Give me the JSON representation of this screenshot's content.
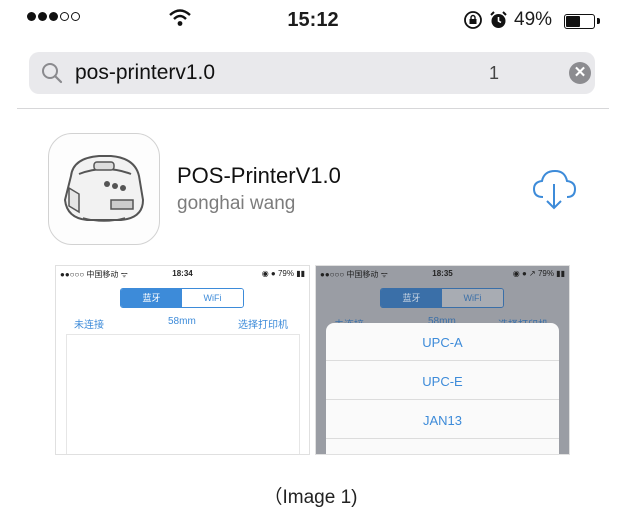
{
  "status_bar": {
    "signal_icon": "signal-dots-icon",
    "wifi_icon": "wifi-icon",
    "time": "15:12",
    "lock_icon": "rotation-lock-icon",
    "alarm_icon": "alarm-icon",
    "battery_text": "49%",
    "battery_level": 0.49
  },
  "search": {
    "value": "pos-printerv1.0",
    "result_count": "1",
    "search_icon": "search-icon",
    "clear_icon": "clear-icon"
  },
  "app": {
    "name": "POS-PrinterV1.0",
    "developer": "gonghai wang",
    "icon": "printer-app-icon",
    "download_icon": "cloud-download-icon"
  },
  "screenshot1": {
    "status_left": "●●○○○ 中国移动 ᯤ",
    "time": "18:34",
    "status_right": "◉ ● 79% ▮▮",
    "segments": [
      "蓝牙",
      "WiFi"
    ],
    "options": [
      "未连接",
      "58mm",
      "选择打印机"
    ]
  },
  "screenshot2": {
    "status_left": "●●○○○ 中国移动 ᯤ",
    "time": "18:35",
    "status_right": "◉ ● ↗ 79% ▮▮",
    "segments": [
      "蓝牙",
      "WiFi"
    ],
    "options": [
      "未连接",
      "58mm",
      "选择打印机"
    ],
    "sheet_items": [
      "UPC-A",
      "UPC-E",
      "JAN13"
    ]
  },
  "caption": "（Image 1)",
  "colors": {
    "accent": "#3d8bd9",
    "search_bg": "#e9e9ec",
    "secondary_text": "#7c7c7c"
  }
}
